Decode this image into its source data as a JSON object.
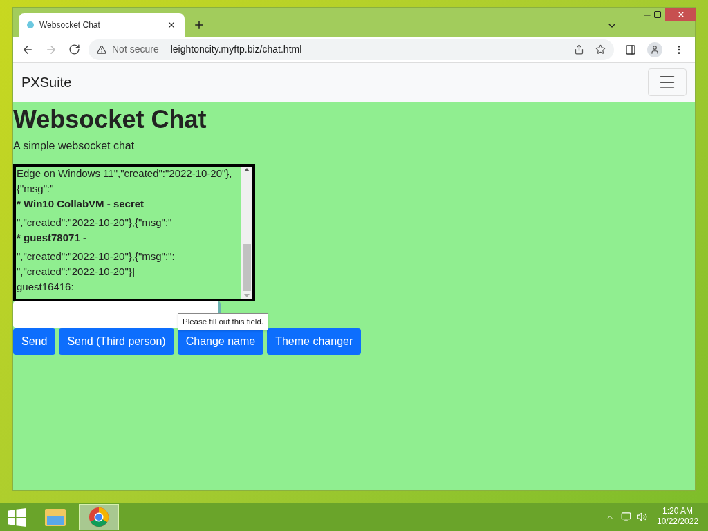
{
  "browser": {
    "tab": {
      "title": "Websocket Chat",
      "selected": true
    },
    "security": "Not secure",
    "url": "leightoncity.myftp.biz/chat.html"
  },
  "navbar": {
    "brand": "PXSuite"
  },
  "page": {
    "heading": "Websocket Chat",
    "subtitle": "A simple websocket chat",
    "chat_lines": [
      {
        "kind": "plain",
        "text": "Edge on Windows 11\",\"created\":\"2022-10-20\"},{\"msg\":\""
      },
      {
        "kind": "bold",
        "text": "* Win10 CollabVM - secret"
      },
      {
        "kind": "plain",
        "text": "\",\"created\":\"2022-10-20\"},{\"msg\":\""
      },
      {
        "kind": "bold",
        "text": "* guest78071 -"
      },
      {
        "kind": "plain",
        "text": "\",\"created\":\"2022-10-20\"},{\"msg\":\":"
      },
      {
        "kind": "plain",
        "text": "\",\"created\":\"2022-10-20\"}]"
      },
      {
        "kind": "plain",
        "text": "guest16416:"
      }
    ],
    "buttons": [
      "Send",
      "Send (Third person)",
      "Change name",
      "Theme changer"
    ],
    "tooltip": "Please fill out this field."
  },
  "taskbar": {
    "time": "1:20 AM",
    "date": "10/22/2022"
  }
}
